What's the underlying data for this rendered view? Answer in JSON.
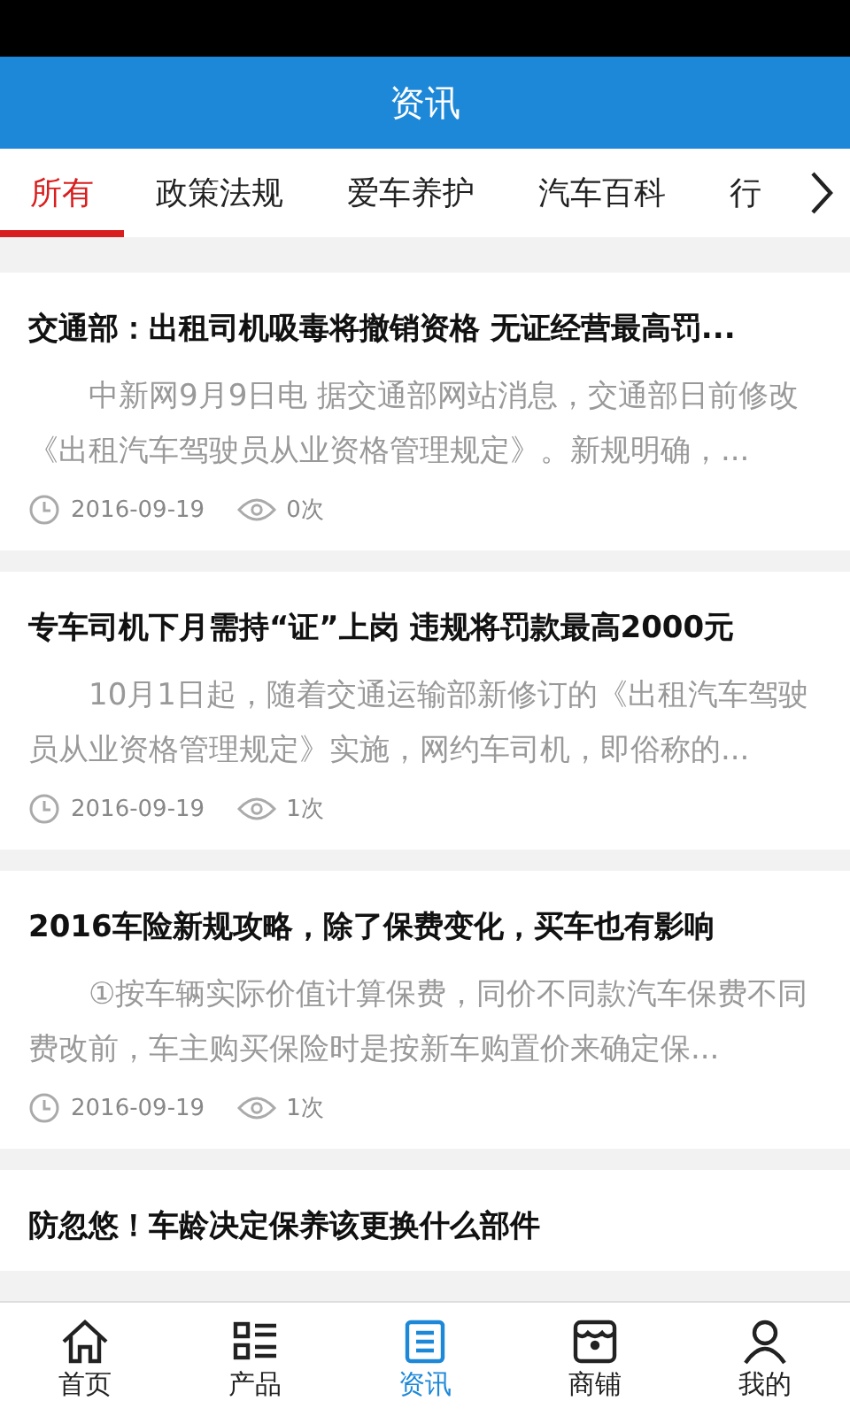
{
  "header": {
    "title": "资讯"
  },
  "tabs": [
    {
      "label": "所有",
      "selected": true
    },
    {
      "label": "政策法规",
      "selected": false
    },
    {
      "label": "爱车养护",
      "selected": false
    },
    {
      "label": "汽车百科",
      "selected": false
    },
    {
      "label": "行",
      "selected": false
    }
  ],
  "articles": [
    {
      "title": "交通部：出租司机吸毒将撤销资格 无证经营最高罚...",
      "summary": "中新网9月9日电 据交通部网站消息，交通部日前修改《出租汽车驾驶员从业资格管理规定》。新规明确，...",
      "date": "2016-09-19",
      "views": "0次"
    },
    {
      "title": "专车司机下月需持“证”上岗 违规将罚款最高2000元",
      "summary": "10月1日起，随着交通运输部新修订的《出租汽车驾驶员从业资格管理规定》实施，网约车司机，即俗称的...",
      "date": "2016-09-19",
      "views": "1次"
    },
    {
      "title": "2016车险新规攻略，除了保费变化，买车也有影响",
      "summary": "①按车辆实际价值计算保费，同价不同款汽车保费不同费改前，车主购买保险时是按新车购置价来确定保...",
      "date": "2016-09-19",
      "views": "1次"
    },
    {
      "title": "防忽悠！车龄决定保养该更换什么部件"
    }
  ],
  "bottom_nav": [
    {
      "kind": "home",
      "label": "首页",
      "selected": false
    },
    {
      "kind": "products",
      "label": "产品",
      "selected": false
    },
    {
      "kind": "news",
      "label": "资讯",
      "selected": true
    },
    {
      "kind": "shop",
      "label": "商铺",
      "selected": false
    },
    {
      "kind": "profile",
      "label": "我的",
      "selected": false
    }
  ]
}
